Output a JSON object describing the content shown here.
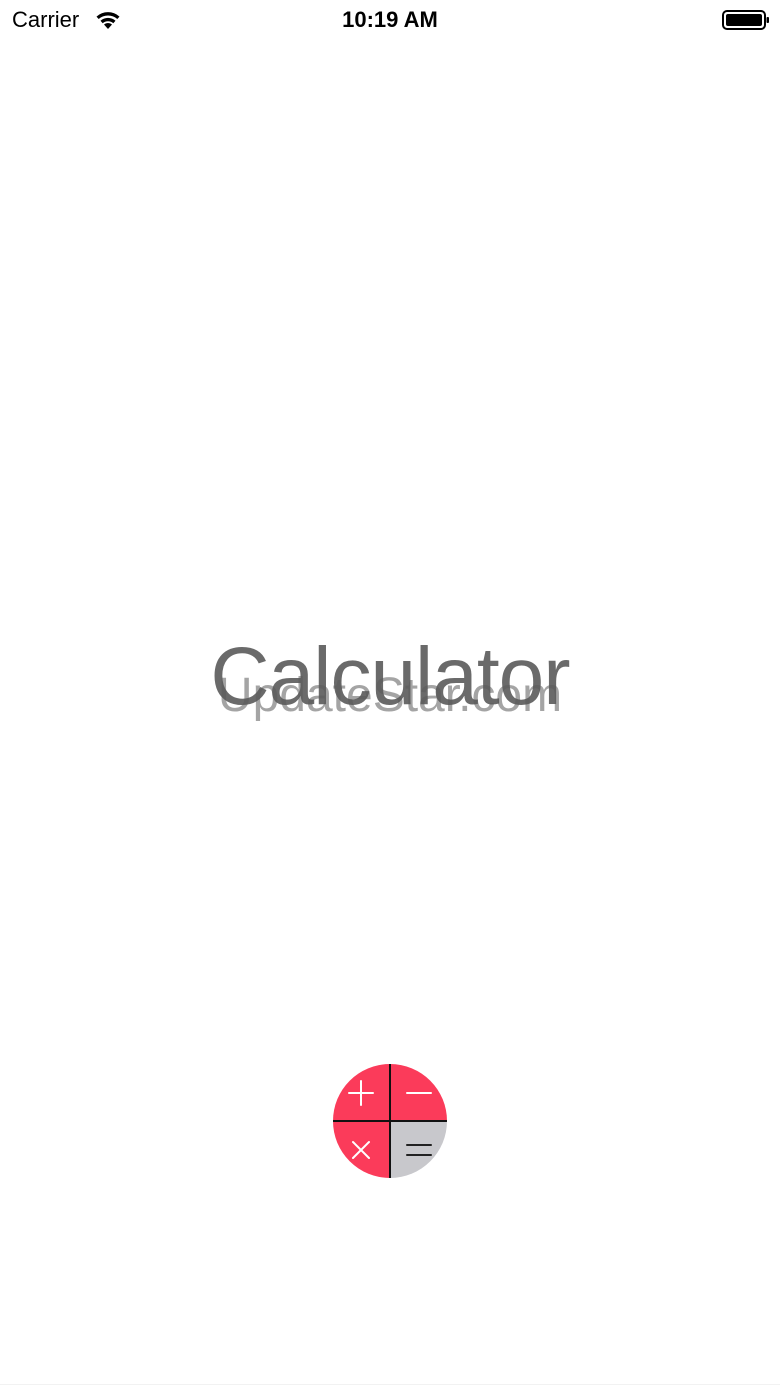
{
  "status_bar": {
    "carrier": "Carrier",
    "time": "10:19 AM",
    "wifi_icon": "wifi-icon",
    "battery_icon": "battery-icon"
  },
  "splash": {
    "title": "Calculator",
    "watermark": "UpdateStar.com"
  },
  "logo": {
    "icon": "calculator-logo-icon",
    "accent_color": "#fb3b5a",
    "neutral_color": "#c8c8cc",
    "glyphs": {
      "plus": "+",
      "minus": "−",
      "times": "×",
      "equals": "="
    }
  }
}
